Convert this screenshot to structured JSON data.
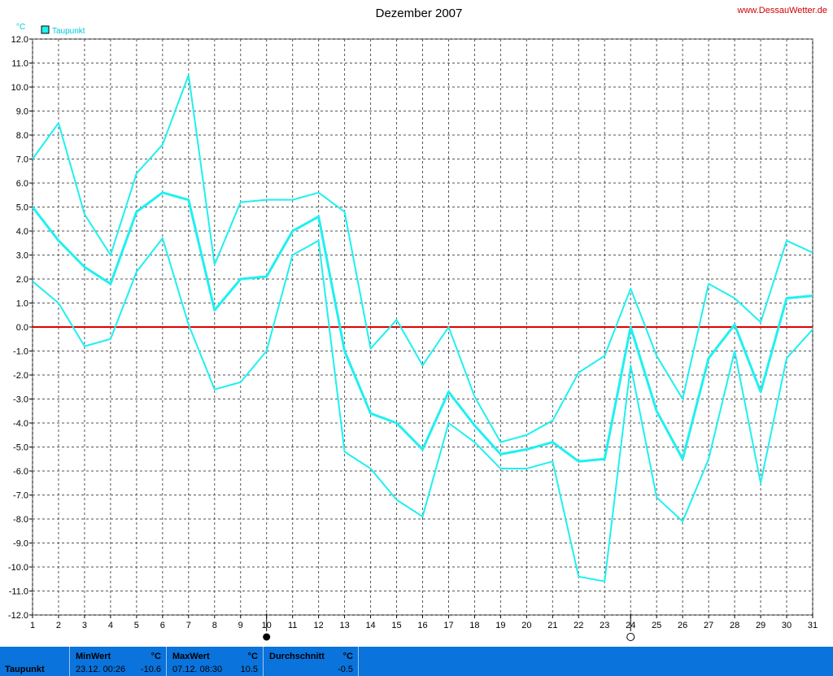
{
  "site": "www.DessauWetter.de",
  "chart_data": {
    "type": "line",
    "title": "Dezember 2007",
    "ylabel": "°C",
    "legend": "Taupunkt",
    "legend_placement": "top-left",
    "grid": true,
    "ylim": [
      -12,
      12
    ],
    "yticks": [
      "12.0",
      "11.0",
      "10.0",
      "9.0",
      "8.0",
      "7.0",
      "6.0",
      "5.0",
      "4.0",
      "3.0",
      "2.0",
      "1.0",
      "0.0",
      "-1.0",
      "-2.0",
      "-3.0",
      "-4.0",
      "-5.0",
      "-6.0",
      "-7.0",
      "-8.0",
      "-9.0",
      "-10.0",
      "-11.0",
      "-12.0"
    ],
    "x": [
      1,
      2,
      3,
      4,
      5,
      6,
      7,
      8,
      9,
      10,
      11,
      12,
      13,
      14,
      15,
      16,
      17,
      18,
      19,
      20,
      21,
      22,
      23,
      24,
      25,
      26,
      27,
      28,
      29,
      30,
      31
    ],
    "series": [
      {
        "name": "Max",
        "values": [
          7.0,
          8.5,
          4.7,
          3.0,
          6.4,
          7.6,
          10.5,
          2.6,
          5.2,
          5.3,
          5.3,
          5.6,
          4.8,
          -0.9,
          0.3,
          -1.6,
          0.0,
          -2.9,
          -4.8,
          -4.5,
          -3.9,
          -1.9,
          -1.2,
          1.6,
          -1.2,
          -3.0,
          1.8,
          1.2,
          0.2,
          3.6,
          3.1
        ]
      },
      {
        "name": "Mittel",
        "values": [
          5.0,
          3.6,
          2.5,
          1.8,
          4.8,
          5.6,
          5.3,
          0.7,
          2.0,
          2.1,
          4.0,
          4.6,
          -1.0,
          -3.6,
          -4.0,
          -5.1,
          -2.7,
          -4.1,
          -5.3,
          -5.1,
          -4.8,
          -5.6,
          -5.5,
          0.0,
          -3.5,
          -5.5,
          -1.3,
          0.1,
          -2.7,
          1.2,
          1.3
        ]
      },
      {
        "name": "Min",
        "values": [
          1.9,
          1.0,
          -0.8,
          -0.5,
          2.3,
          3.7,
          0.1,
          -2.6,
          -2.3,
          -1.0,
          3.0,
          3.6,
          -5.2,
          -5.9,
          -7.2,
          -7.9,
          -4.0,
          -4.8,
          -5.9,
          -5.9,
          -5.6,
          -10.4,
          -10.6,
          -1.6,
          -7.1,
          -8.1,
          -5.5,
          -1.0,
          -6.5,
          -1.3,
          -0.1
        ]
      }
    ],
    "series_color": "#1ff0f0",
    "zero_line_color": "#e00000",
    "markers": {
      "min_day": 23,
      "max_day": 7
    }
  },
  "footer": {
    "series_name": "Taupunkt",
    "min_header": "MinWert",
    "min_unit": "°C",
    "min_time": "23.12.  00:26",
    "min_value": "-10.6",
    "max_header": "MaxWert",
    "max_unit": "°C",
    "max_time": "07.12.  08:30",
    "max_value": "10.5",
    "avg_header": "Durchschnitt",
    "avg_unit": "°C",
    "avg_value": "-0.5"
  }
}
